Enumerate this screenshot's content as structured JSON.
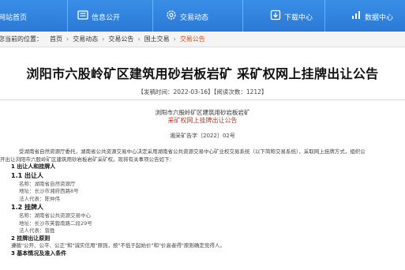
{
  "nav": {
    "items": [
      {
        "label": "网站首页",
        "icon": "home-icon"
      },
      {
        "label": "信息公开",
        "icon": "info-icon"
      },
      {
        "label": "交易动态",
        "icon": "settings-icon"
      },
      {
        "label": "下载中心",
        "icon": "download-icon"
      },
      {
        "label": "数据中心",
        "icon": "chart-icon"
      }
    ]
  },
  "breadcrumb": {
    "prefix": "您当前的位置：",
    "items": [
      "首页",
      "交易动态",
      "交易公告",
      "国土交易",
      "交易公告"
    ]
  },
  "article": {
    "title": "浏阳市六股岭矿区建筑用砂岩板岩矿 采矿权网上挂牌出让公告",
    "meta": "【发稿时间：2022-03-16】【阅读次数：1212】",
    "subtitle_line1": "浏阳市六股岭矿区建筑用砂岩板岩矿",
    "subtitle_line2": "采矿权网上挂牌出让公告",
    "doc_number": "湘采矿告字〔2022〕02号",
    "paragraph1_a": "受湖南省自然资源厅委托，湖南省公共资源交易中心决定采用湖南省公共资源交易中心矿业权交易系统（以下简称交易系统），采取网上挂牌方式，组织公",
    "paragraph1_b": "开出让浏阳市六股岭矿区建筑用砂岩板岩矿采矿权。现将有关事项公告如下：",
    "section1": "1 出让人和挂牌人",
    "s1_1": "1.1 出让人",
    "s1_1_name": "名称：湖南省自然资源厅",
    "s1_1_addr": "地址：长沙市湘府西路8号",
    "s1_1_rep": "法人代表：陈仲伟",
    "s1_2": "1.2 挂牌人",
    "s1_2_name": "名称：湖南省公共资源交易中心",
    "s1_2_addr": "地址：长沙市芙蓉南路二段29号",
    "s1_2_rep": "法人代表：曾胜",
    "section2": "2 挂牌出让原则",
    "section2_text": "遵循\"公开、公平、公正\"和\"诚实信用\"原则，按\"不低于起始价\"和\"价高者得\"原则确定竞得人。",
    "section3": "3 基本情况及准入条件"
  }
}
